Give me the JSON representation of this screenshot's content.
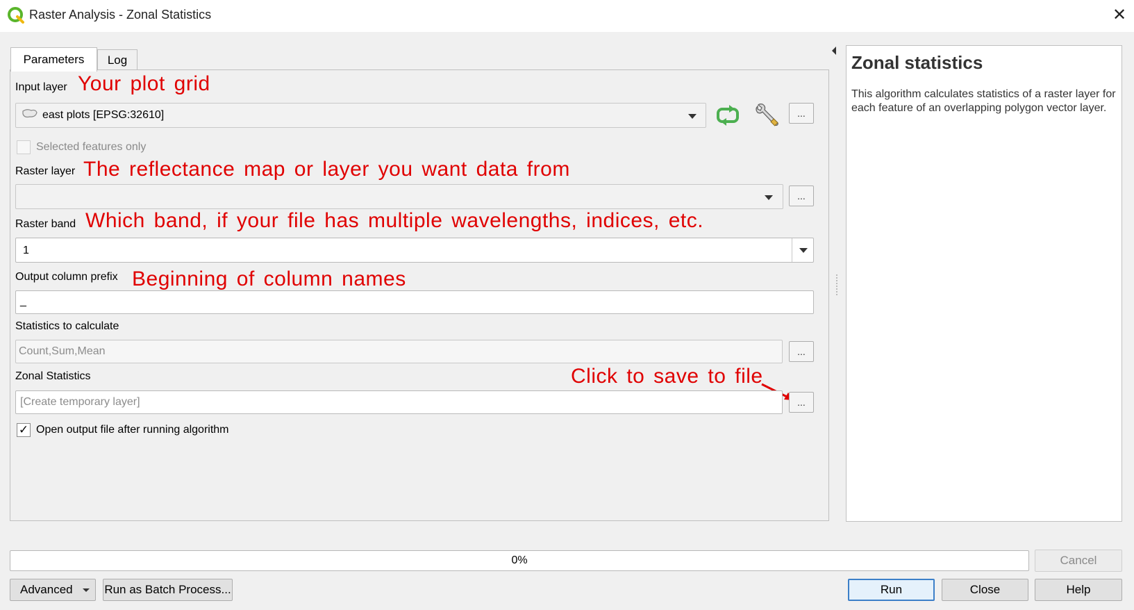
{
  "window": {
    "title": "Raster Analysis - Zonal Statistics",
    "close_glyph": "✕",
    "icon": "qgis-logo-icon"
  },
  "tabs": [
    {
      "label": "Parameters",
      "active": true
    },
    {
      "label": "Log",
      "active": false
    }
  ],
  "params": {
    "input_layer": {
      "label": "Input layer",
      "annotation": "Your plot grid",
      "value": "east plots [EPSG:32610]",
      "value_icon": "polygon-layer-icon",
      "iterate_icon": "iterate-icon",
      "settings_icon": "wrench-icon",
      "dots_label": "..."
    },
    "selected_only": {
      "label": "Selected features only",
      "checked": false
    },
    "raster_layer": {
      "label": "Raster layer",
      "annotation": "The reflectance map or layer you want data from",
      "value": "",
      "dots_label": "..."
    },
    "raster_band": {
      "label": "Raster band",
      "annotation": "Which band, if your file has multiple wavelengths, indices, etc.",
      "value": "1"
    },
    "column_prefix": {
      "label": "Output column prefix",
      "annotation": "Beginning of column names",
      "value": "_"
    },
    "statistics": {
      "label": "Statistics to calculate",
      "value": "Count,Sum,Mean",
      "dots_label": "..."
    },
    "zonal_stats": {
      "label": "Zonal Statistics",
      "annotation": "Click to save to file",
      "placeholder": "[Create temporary layer]",
      "dots_label": "..."
    },
    "open_output": {
      "label": "Open output file after running algorithm",
      "checked": true,
      "check_glyph": "✓"
    }
  },
  "help": {
    "title": "Zonal statistics",
    "text": "This algorithm calculates statistics of a raster layer for each feature of an overlapping polygon vector layer."
  },
  "footer": {
    "progress_label": "0%",
    "progress_value": 0,
    "cancel_label": "Cancel",
    "advanced_label": "Advanced",
    "batch_label": "Run as Batch Process...",
    "run_label": "Run",
    "close_label": "Close",
    "help_label": "Help"
  },
  "colors": {
    "annotation": "#e00000",
    "default_button_border": "#3c7fc8",
    "qgis_green": "#5ab52b"
  }
}
